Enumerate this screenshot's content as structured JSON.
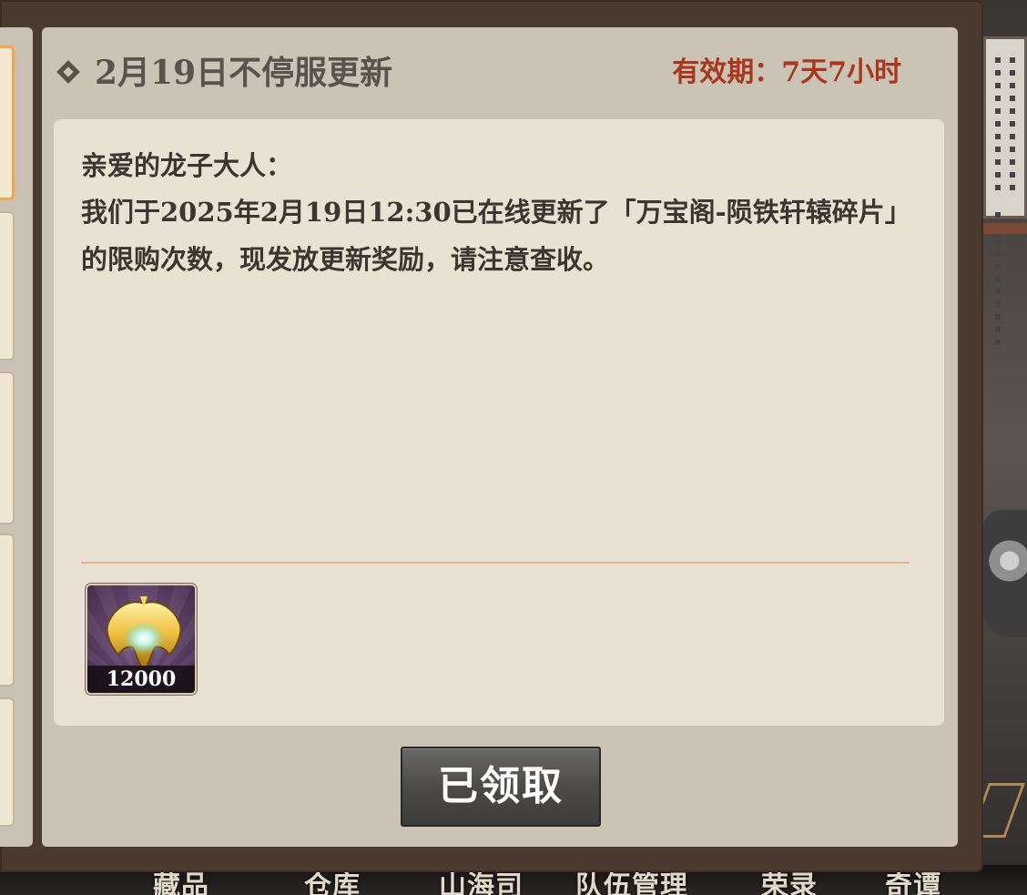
{
  "mail": {
    "title": "2月19日不停服更新",
    "expiry": "有效期：7天7小时",
    "greeting": "亲爱的龙子大人：",
    "body": "我们于2025年2月19日12:30已在线更新了「万宝阁-陨铁轩辕碎片」的限购次数，现发放更新奖励，请注意查收。",
    "reward": {
      "icon": "golden-fan-shard-icon",
      "count": "12000"
    },
    "claim_button": "已领取"
  },
  "bottom_nav": [
    "藏品",
    "仓库",
    "山海司",
    "队伍管理",
    "荣录",
    "奇谭"
  ],
  "colors": {
    "expiry_red": "#a8371d",
    "panel": "#cbc4b6",
    "content_bg": "#e9e2d2",
    "frame": "#4b3a30",
    "button": "#4d4b49"
  }
}
